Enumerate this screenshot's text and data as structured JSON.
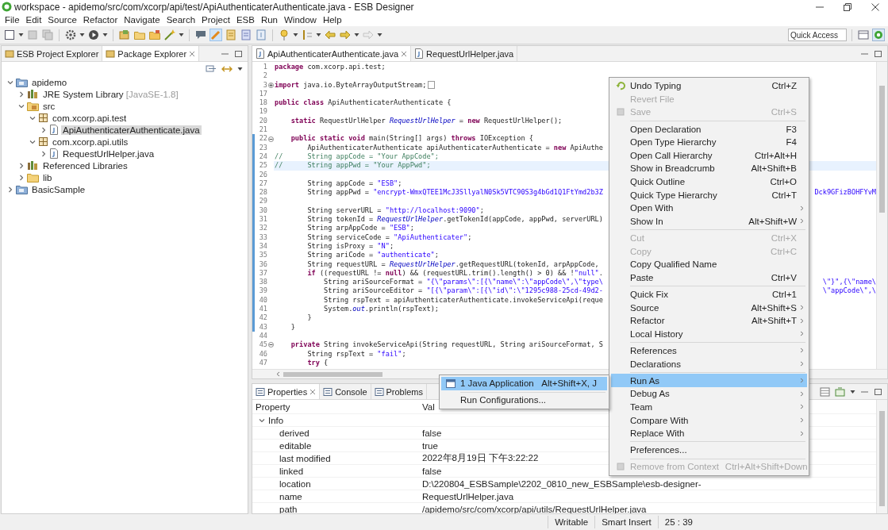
{
  "window": {
    "title": "workspace - apidemo/src/com/xcorp/api/test/ApiAuthenticaterAuthenticate.java - ESB Designer"
  },
  "menu_bar": [
    "File",
    "Edit",
    "Source",
    "Refactor",
    "Navigate",
    "Search",
    "Project",
    "ESB",
    "Run",
    "Window",
    "Help"
  ],
  "toolbar": {
    "quick_access": {
      "placeholder": "Quick Access"
    }
  },
  "left_panel": {
    "tabs": [
      {
        "label": "ESB Project Explorer",
        "selected": false
      },
      {
        "label": "Package Explorer",
        "selected": true
      }
    ],
    "tree": [
      {
        "label": "apidemo",
        "kind": "project",
        "expanded": true,
        "selected": false,
        "children": [
          {
            "label": "JRE System Library",
            "decoration": "[JavaSE-1.8]",
            "kind": "library",
            "expanded": false,
            "selected": false
          },
          {
            "label": "src",
            "kind": "source-folder",
            "expanded": true,
            "selected": false,
            "children": [
              {
                "label": "com.xcorp.api.test",
                "kind": "package",
                "expanded": true,
                "selected": false,
                "children": [
                  {
                    "label": "ApiAuthenticaterAuthenticate.java",
                    "kind": "java-file",
                    "expanded": false,
                    "selected": true
                  }
                ]
              },
              {
                "label": "com.xcorp.api.utils",
                "kind": "package",
                "expanded": true,
                "selected": false,
                "children": [
                  {
                    "label": "RequestUrlHelper.java",
                    "kind": "java-file",
                    "expanded": false,
                    "selected": false
                  }
                ]
              }
            ]
          },
          {
            "label": "Referenced Libraries",
            "kind": "library",
            "expanded": false,
            "selected": false
          },
          {
            "label": "lib",
            "kind": "folder",
            "expanded": false,
            "selected": false
          }
        ]
      },
      {
        "label": "BasicSample",
        "kind": "project",
        "expanded": false,
        "selected": false
      }
    ]
  },
  "editor": {
    "tabs": [
      {
        "label": "ApiAuthenticaterAuthenticate.java",
        "selected": true
      },
      {
        "label": "RequestUrlHelper.java",
        "selected": false
      }
    ],
    "lines": [
      {
        "number": "1",
        "changed": false,
        "current": false,
        "segments": [
          {
            "kind": "keyword",
            "text": "package"
          },
          {
            "kind": "plain",
            "text": " com.xcorp.api.test;"
          }
        ]
      },
      {
        "number": "2",
        "changed": false,
        "current": false
      },
      {
        "number": "3",
        "changed": false,
        "current": false,
        "folded": true,
        "segments": [
          {
            "kind": "keyword",
            "text": "import"
          },
          {
            "kind": "plain",
            "text": " java.io.ByteArrayOutputStream;"
          }
        ]
      },
      {
        "number": "17",
        "changed": false,
        "current": false
      },
      {
        "number": "18",
        "changed": false,
        "current": false,
        "segments": [
          {
            "kind": "keyword",
            "text": "public class"
          },
          {
            "kind": "plain",
            "text": " ApiAuthenticaterAuthenticate {"
          }
        ]
      },
      {
        "number": "19",
        "changed": false,
        "current": false
      },
      {
        "number": "20",
        "changed": false,
        "current": false,
        "segments": [
          {
            "kind": "keyword",
            "text": "    static"
          },
          {
            "kind": "plain",
            "text": " RequestUrlHelper "
          },
          {
            "kind": "field",
            "text": "RequestUrlHelper"
          },
          {
            "kind": "plain",
            "text": " = "
          },
          {
            "kind": "keyword",
            "text": "new"
          },
          {
            "kind": "plain",
            "text": " RequestUrlHelper();"
          }
        ]
      },
      {
        "number": "21",
        "changed": false,
        "current": false
      },
      {
        "number": "22",
        "changed": true,
        "current": false,
        "folded": false,
        "segments": [
          {
            "kind": "keyword",
            "text": "    public static void"
          },
          {
            "kind": "plain",
            "text": " main(String[] args) "
          },
          {
            "kind": "keyword",
            "text": "throws"
          },
          {
            "kind": "plain",
            "text": " IOException {"
          }
        ]
      },
      {
        "number": "23",
        "changed": true,
        "current": false,
        "segments": [
          {
            "kind": "plain",
            "text": "        ApiAuthenticaterAuthenticate apiAuthenticaterAuthenticate = "
          },
          {
            "kind": "keyword",
            "text": "new"
          },
          {
            "kind": "plain",
            "text": " ApiAuthe"
          }
        ]
      },
      {
        "number": "24",
        "changed": true,
        "current": false,
        "segments": [
          {
            "kind": "comment",
            "text": "//      String appCode = \"Your AppCode\";"
          }
        ]
      },
      {
        "number": "25",
        "changed": true,
        "current": true,
        "segments": [
          {
            "kind": "comment",
            "text": "//      String appPwd = \"Your AppPwd\";"
          }
        ]
      },
      {
        "number": "26",
        "changed": true,
        "current": false
      },
      {
        "number": "27",
        "changed": true,
        "current": false,
        "segments": [
          {
            "kind": "plain",
            "text": "        String appCode = "
          },
          {
            "kind": "string",
            "text": "\"ESB\""
          },
          {
            "kind": "plain",
            "text": ";"
          }
        ]
      },
      {
        "number": "28",
        "changed": true,
        "current": false,
        "segments": [
          {
            "kind": "plain",
            "text": "        String appPwd = "
          },
          {
            "kind": "string",
            "text": "\"encrypt-WmxQTEE1McJ3SllyalN0Sk5VTC90S3g4bGd1Q1FtYmd2b3Z"
          }
        ],
        "tail": [
          {
            "kind": "string",
            "text": "Dck9GFizBOHFYvM"
          }
        ]
      },
      {
        "number": "29",
        "changed": true,
        "current": false
      },
      {
        "number": "30",
        "changed": true,
        "current": false,
        "segments": [
          {
            "kind": "plain",
            "text": "        String serverURL = "
          },
          {
            "kind": "string",
            "text": "\"http://localhost:9090\""
          },
          {
            "kind": "plain",
            "text": ";"
          }
        ]
      },
      {
        "number": "31",
        "changed": true,
        "current": false,
        "segments": [
          {
            "kind": "plain",
            "text": "        String tokenId = "
          },
          {
            "kind": "field",
            "text": "RequestUrlHelper"
          },
          {
            "kind": "plain",
            "text": ".getTokenId(appCode, appPwd, serverURL)"
          }
        ]
      },
      {
        "number": "32",
        "changed": true,
        "current": false,
        "segments": [
          {
            "kind": "plain",
            "text": "        String arpAppCode = "
          },
          {
            "kind": "string",
            "text": "\"ESB\""
          },
          {
            "kind": "plain",
            "text": ";"
          }
        ]
      },
      {
        "number": "33",
        "changed": true,
        "current": false,
        "segments": [
          {
            "kind": "plain",
            "text": "        String serviceCode = "
          },
          {
            "kind": "string",
            "text": "\"ApiAuthenticater\""
          },
          {
            "kind": "plain",
            "text": ";"
          }
        ]
      },
      {
        "number": "34",
        "changed": true,
        "current": false,
        "segments": [
          {
            "kind": "plain",
            "text": "        String isProxy = "
          },
          {
            "kind": "string",
            "text": "\"N\""
          },
          {
            "kind": "plain",
            "text": ";"
          }
        ]
      },
      {
        "number": "35",
        "changed": true,
        "current": false,
        "segments": [
          {
            "kind": "plain",
            "text": "        String ariCode = "
          },
          {
            "kind": "string",
            "text": "\"authenticate\""
          },
          {
            "kind": "plain",
            "text": ";"
          }
        ]
      },
      {
        "number": "36",
        "changed": true,
        "current": false,
        "segments": [
          {
            "kind": "plain",
            "text": "        String requestURL = "
          },
          {
            "kind": "field",
            "text": "RequestUrlHelper"
          },
          {
            "kind": "plain",
            "text": ".getRequestURL(tokenId, arpAppCode,"
          }
        ]
      },
      {
        "number": "37",
        "changed": true,
        "current": false,
        "segments": [
          {
            "kind": "keyword",
            "text": "        if"
          },
          {
            "kind": "plain",
            "text": " ((requestURL != "
          },
          {
            "kind": "keyword",
            "text": "null"
          },
          {
            "kind": "plain",
            "text": ") && (requestURL.trim().length() > 0) && !"
          },
          {
            "kind": "string",
            "text": "\"null\""
          },
          {
            "kind": "plain",
            "text": "."
          }
        ]
      },
      {
        "number": "38",
        "changed": true,
        "current": false,
        "segments": [
          {
            "kind": "plain",
            "text": "            String ariSourceFormat = "
          },
          {
            "kind": "string",
            "text": "\"{\\\"params\\\":[{\\\"name\\\":\\\"appCode\\\",\\\"type\\"
          }
        ],
        "tail": [
          {
            "kind": "string",
            "text": "\\\"}\",{\\\"name\\"
          }
        ]
      },
      {
        "number": "39",
        "changed": true,
        "current": false,
        "segments": [
          {
            "kind": "plain",
            "text": "            String ariSourceEditor = "
          },
          {
            "kind": "string",
            "text": "\"[{\\\"param\\\":[{\\\"id\\\":\\\"1295c988-25cd-49d2-"
          }
        ],
        "tail": [
          {
            "kind": "string",
            "text": "\\\"appCode\\\",\\"
          }
        ]
      },
      {
        "number": "40",
        "changed": true,
        "current": false,
        "segments": [
          {
            "kind": "plain",
            "text": "            String rspText = apiAuthenticaterAuthenticate.invokeServiceApi(reque"
          }
        ]
      },
      {
        "number": "41",
        "changed": true,
        "current": false,
        "segments": [
          {
            "kind": "plain",
            "text": "            System."
          },
          {
            "kind": "field",
            "text": "out"
          },
          {
            "kind": "plain",
            "text": ".println(rspText);"
          }
        ]
      },
      {
        "number": "42",
        "changed": true,
        "current": false,
        "segments": [
          {
            "kind": "plain",
            "text": "        }"
          }
        ]
      },
      {
        "number": "43",
        "changed": true,
        "current": false,
        "segments": [
          {
            "kind": "plain",
            "text": "    }"
          }
        ]
      },
      {
        "number": "44",
        "changed": false,
        "current": false
      },
      {
        "number": "45",
        "changed": false,
        "current": false,
        "folded": false,
        "segments": [
          {
            "kind": "keyword",
            "text": "    private"
          },
          {
            "kind": "plain",
            "text": " String invokeServiceApi(String requestURL, String ariSourceFormat, S"
          }
        ]
      },
      {
        "number": "46",
        "changed": false,
        "current": false,
        "segments": [
          {
            "kind": "plain",
            "text": "        String rspText = "
          },
          {
            "kind": "string",
            "text": "\"fail\""
          },
          {
            "kind": "plain",
            "text": ";"
          }
        ]
      },
      {
        "number": "47",
        "changed": false,
        "current": false,
        "segments": [
          {
            "kind": "keyword",
            "text": "        try"
          },
          {
            "kind": "plain",
            "text": " {"
          }
        ]
      }
    ]
  },
  "properties_panel": {
    "tabs": [
      {
        "label": "Properties",
        "selected": true
      },
      {
        "label": "Console",
        "selected": false
      },
      {
        "label": "Problems",
        "selected": false
      }
    ],
    "columns": [
      "Property",
      "Val"
    ],
    "groups": [
      {
        "label": "Info",
        "expanded": true,
        "rows": [
          {
            "property": "derived",
            "value": "false"
          },
          {
            "property": "editable",
            "value": "true"
          },
          {
            "property": "last modified",
            "value": "2022年8月19日 下午3:22:22"
          },
          {
            "property": "linked",
            "value": "false"
          },
          {
            "property": "location",
            "value": "D:\\220804_ESBSample\\2202_0810_new_ESBSample\\esb-designer-"
          },
          {
            "property": "name",
            "value": "RequestUrlHelper.java"
          },
          {
            "property": "path",
            "value": "/apidemo/src/com/xcorp/api/utils/RequestUrlHelper.java"
          }
        ]
      }
    ]
  },
  "context_menu": {
    "items": [
      {
        "kind": "item",
        "label": "Undo Typing",
        "shortcut": "Ctrl+Z",
        "icon": true,
        "disabled": false,
        "submenu": false,
        "selected": false
      },
      {
        "kind": "item",
        "label": "Revert File",
        "disabled": true,
        "submenu": false,
        "selected": false
      },
      {
        "kind": "item",
        "label": "Save",
        "shortcut": "Ctrl+S",
        "icon": true,
        "disabled": true,
        "submenu": false,
        "selected": false
      },
      {
        "kind": "separator"
      },
      {
        "kind": "item",
        "label": "Open Declaration",
        "shortcut": "F3",
        "disabled": false,
        "submenu": false,
        "selected": false
      },
      {
        "kind": "item",
        "label": "Open Type Hierarchy",
        "shortcut": "F4",
        "disabled": false,
        "submenu": false,
        "selected": false
      },
      {
        "kind": "item",
        "label": "Open Call Hierarchy",
        "shortcut": "Ctrl+Alt+H",
        "disabled": false,
        "submenu": false,
        "selected": false
      },
      {
        "kind": "item",
        "label": "Show in Breadcrumb",
        "shortcut": "Alt+Shift+B",
        "disabled": false,
        "submenu": false,
        "selected": false
      },
      {
        "kind": "item",
        "label": "Quick Outline",
        "shortcut": "Ctrl+O",
        "disabled": false,
        "submenu": false,
        "selected": false
      },
      {
        "kind": "item",
        "label": "Quick Type Hierarchy",
        "shortcut": "Ctrl+T",
        "disabled": false,
        "submenu": false,
        "selected": false
      },
      {
        "kind": "item",
        "label": "Open With",
        "disabled": false,
        "submenu": true,
        "selected": false
      },
      {
        "kind": "item",
        "label": "Show In",
        "shortcut": "Alt+Shift+W",
        "disabled": false,
        "submenu": true,
        "selected": false
      },
      {
        "kind": "separator"
      },
      {
        "kind": "item",
        "label": "Cut",
        "shortcut": "Ctrl+X",
        "disabled": true,
        "submenu": false,
        "selected": false
      },
      {
        "kind": "item",
        "label": "Copy",
        "shortcut": "Ctrl+C",
        "disabled": true,
        "submenu": false,
        "selected": false
      },
      {
        "kind": "item",
        "label": "Copy Qualified Name",
        "disabled": false,
        "submenu": false,
        "selected": false
      },
      {
        "kind": "item",
        "label": "Paste",
        "shortcut": "Ctrl+V",
        "disabled": false,
        "submenu": false,
        "selected": false
      },
      {
        "kind": "separator"
      },
      {
        "kind": "item",
        "label": "Quick Fix",
        "shortcut": "Ctrl+1",
        "disabled": false,
        "submenu": false,
        "selected": false
      },
      {
        "kind": "item",
        "label": "Source",
        "shortcut": "Alt+Shift+S",
        "disabled": false,
        "submenu": true,
        "selected": false
      },
      {
        "kind": "item",
        "label": "Refactor",
        "shortcut": "Alt+Shift+T",
        "disabled": false,
        "submenu": true,
        "selected": false
      },
      {
        "kind": "item",
        "label": "Local History",
        "disabled": false,
        "submenu": true,
        "selected": false
      },
      {
        "kind": "separator"
      },
      {
        "kind": "item",
        "label": "References",
        "disabled": false,
        "submenu": true,
        "selected": false
      },
      {
        "kind": "item",
        "label": "Declarations",
        "disabled": false,
        "submenu": true,
        "selected": false
      },
      {
        "kind": "separator"
      },
      {
        "kind": "item",
        "label": "Run As",
        "disabled": false,
        "submenu": true,
        "selected": true
      },
      {
        "kind": "item",
        "label": "Debug As",
        "disabled": false,
        "submenu": true,
        "selected": false
      },
      {
        "kind": "item",
        "label": "Team",
        "disabled": false,
        "submenu": true,
        "selected": false
      },
      {
        "kind": "item",
        "label": "Compare With",
        "disabled": false,
        "submenu": true,
        "selected": false
      },
      {
        "kind": "item",
        "label": "Replace With",
        "disabled": false,
        "submenu": true,
        "selected": false
      },
      {
        "kind": "separator"
      },
      {
        "kind": "item",
        "label": "Preferences...",
        "disabled": false,
        "submenu": false,
        "selected": false
      },
      {
        "kind": "separator"
      },
      {
        "kind": "item",
        "label": "Remove from Context",
        "shortcut": "Ctrl+Alt+Shift+Down",
        "icon": true,
        "disabled": true,
        "submenu": false,
        "selected": false
      }
    ]
  },
  "submenu": {
    "items": [
      {
        "kind": "item",
        "label": "1 Java Application",
        "shortcut": "Alt+Shift+X, J",
        "icon": true,
        "disabled": false,
        "submenu": false,
        "selected": true
      },
      {
        "kind": "separator"
      },
      {
        "kind": "item",
        "label": "Run Configurations...",
        "disabled": false,
        "submenu": false,
        "selected": false
      }
    ]
  },
  "status_bar": [
    "Writable",
    "Smart Insert",
    "25 : 39"
  ]
}
